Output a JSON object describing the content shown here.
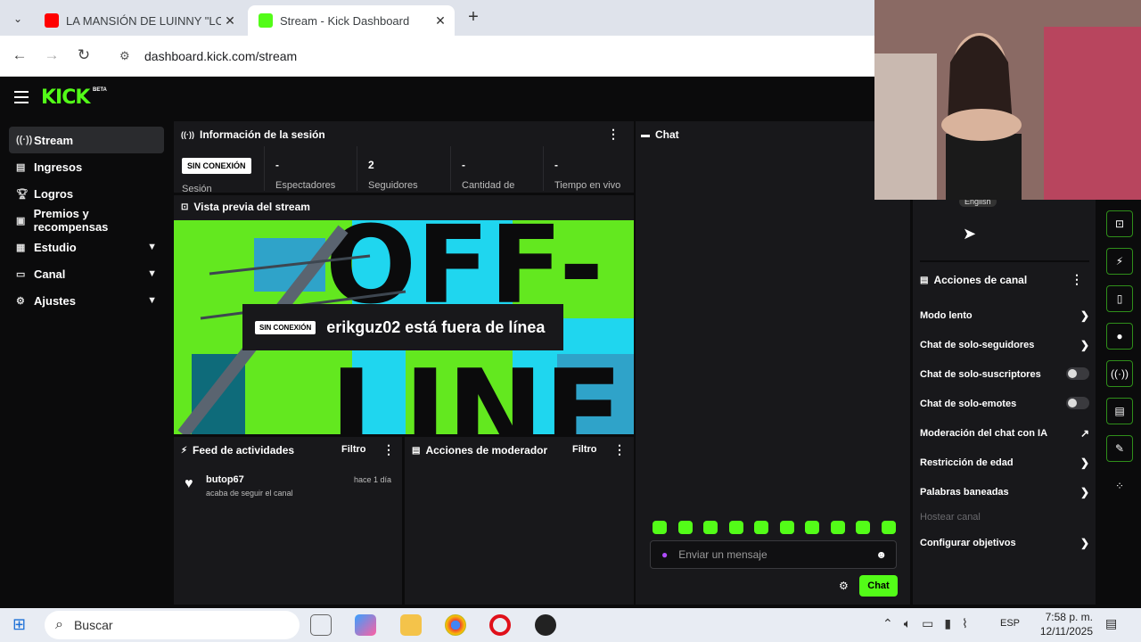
{
  "browser": {
    "tabs": [
      {
        "title": "LA MANSIÓN DE LUINNY \"LOS",
        "active": false,
        "favicon_color": "#ff0000"
      },
      {
        "title": "Stream - Kick Dashboard",
        "active": true,
        "favicon_color": "#53fc18"
      }
    ],
    "url": "dashboard.kick.com/stream"
  },
  "brand": {
    "logo": "KICK",
    "beta": "BETA",
    "accent": "#53fc18"
  },
  "sidebar": {
    "items": [
      {
        "label": "Stream",
        "icon": "broadcast-icon",
        "active": true
      },
      {
        "label": "Ingresos",
        "icon": "chart-icon"
      },
      {
        "label": "Logros",
        "icon": "trophy-icon"
      },
      {
        "label": "Premios y recompensas",
        "icon": "gift-icon"
      },
      {
        "label": "Estudio",
        "icon": "grid-icon",
        "expandable": true
      },
      {
        "label": "Canal",
        "icon": "monitor-icon",
        "expandable": true
      },
      {
        "label": "Ajustes",
        "icon": "gear-icon",
        "expandable": true
      }
    ]
  },
  "session": {
    "title": "Información de la sesión",
    "status_badge": "SIN CONEXIÓN",
    "status_label": "Sesión",
    "stats": [
      {
        "value": "-",
        "label": "Espectadores"
      },
      {
        "value": "2",
        "label": "Seguidores"
      },
      {
        "value": "-",
        "label": "Cantidad de"
      },
      {
        "value": "-",
        "label": "Tiempo en vivo"
      }
    ]
  },
  "preview": {
    "title": "Vista previa del stream",
    "badge": "SIN CONEXIÓN",
    "message": "erikguz02 está fuera de línea"
  },
  "feed": {
    "title": "Feed de actividades",
    "filter": "Filtro",
    "items": [
      {
        "user": "butop67",
        "action": "acaba de seguir el canal",
        "time": "hace 1 día"
      }
    ]
  },
  "mod_actions": {
    "title": "Acciones de moderador",
    "filter": "Filtro"
  },
  "chat": {
    "title": "Chat",
    "placeholder": "Enviar un mensaje",
    "send_label": "Chat",
    "language_tag": "English"
  },
  "channel_actions": {
    "title": "Acciones de canal",
    "items": [
      {
        "label": "Modo lento",
        "control": "chevron"
      },
      {
        "label": "Chat de solo-seguidores",
        "control": "chevron"
      },
      {
        "label": "Chat de solo-suscriptores",
        "control": "toggle",
        "value": false
      },
      {
        "label": "Chat de solo-emotes",
        "control": "toggle",
        "value": false
      },
      {
        "label": "Moderación del chat con IA",
        "control": "external"
      },
      {
        "label": "Restricción de edad",
        "control": "chevron"
      },
      {
        "label": "Palabras baneadas",
        "control": "chevron"
      },
      {
        "label": "Hostear canal",
        "control": "none",
        "disabled": true
      },
      {
        "label": "Configurar objetivos",
        "control": "chevron"
      }
    ]
  },
  "taskbar": {
    "search_placeholder": "Buscar",
    "lang": "ESP",
    "time": "7:58 p. m.",
    "date": "12/11/2025"
  }
}
